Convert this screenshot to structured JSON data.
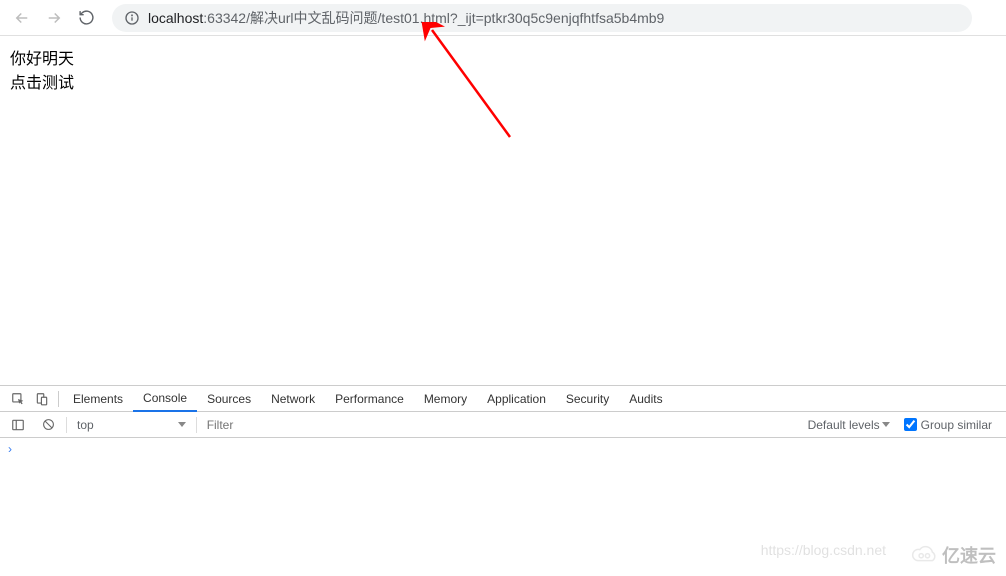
{
  "toolbar": {
    "url_host": "localhost",
    "url_port": ":63342",
    "url_path": "/解决url中文乱码问题/test01.html?_ijt=ptkr30q5c9enjqfhtfsa5b4mb9"
  },
  "page": {
    "line1": "你好明天",
    "line2": "点击测试"
  },
  "devtools": {
    "tabs": {
      "elements": "Elements",
      "console": "Console",
      "sources": "Sources",
      "network": "Network",
      "performance": "Performance",
      "memory": "Memory",
      "application": "Application",
      "security": "Security",
      "audits": "Audits"
    },
    "filter": {
      "context": "top",
      "placeholder": "Filter",
      "levels": "Default levels",
      "group_similar": "Group similar"
    },
    "prompt": "›"
  },
  "watermark": {
    "text": "https://blog.csdn.net",
    "logo_text": "亿速云"
  }
}
